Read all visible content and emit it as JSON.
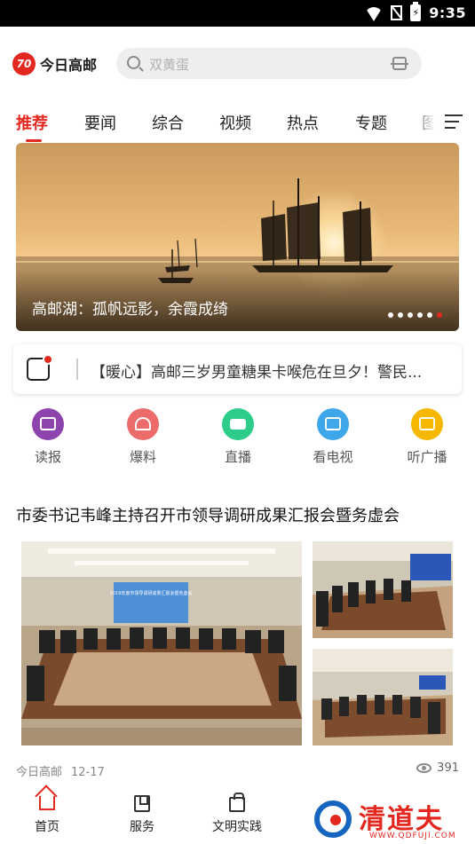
{
  "status_bar": {
    "time": "9:35",
    "battery_glyph": "⚡"
  },
  "header": {
    "logo_mark": "70",
    "logo_text": "今日高邮",
    "search_placeholder": "双黄蛋"
  },
  "tabs": [
    {
      "label": "推荐",
      "active": true
    },
    {
      "label": "要闻"
    },
    {
      "label": "综合"
    },
    {
      "label": "视频"
    },
    {
      "label": "热点"
    },
    {
      "label": "专题"
    },
    {
      "label": "图"
    }
  ],
  "banner": {
    "caption": "高邮湖：孤帆远影，余霞成绮",
    "slide_count": 6,
    "active_slide": 6
  },
  "notice": {
    "text": "【暖心】高邮三岁男童糖果卡喉危在旦夕！警民..."
  },
  "quick_links": [
    {
      "label": "读报",
      "icon": "book-icon",
      "color": "#8e44ad"
    },
    {
      "label": "爆料",
      "icon": "alarm-icon",
      "color": "#ec6b6b"
    },
    {
      "label": "直播",
      "icon": "video-camera-icon",
      "color": "#2ecc8b"
    },
    {
      "label": "看电视",
      "icon": "tv-icon",
      "color": "#3ea7e9"
    },
    {
      "label": "听广播",
      "icon": "radio-icon",
      "color": "#f5b700"
    }
  ],
  "article": {
    "title": "市委书记韦峰主持召开市领导调研成果汇报会暨务虚会",
    "screen_text": "2019年度市领导调研成果汇报会暨务虚会",
    "source": "今日高邮",
    "date": "12-17",
    "views": "391"
  },
  "bottom_nav": [
    {
      "label": "首页",
      "icon": "home-icon",
      "active": true
    },
    {
      "label": "服务",
      "icon": "service-icon"
    },
    {
      "label": "文明实践",
      "icon": "clipboard-icon"
    }
  ],
  "watermark": {
    "text": "清道夫",
    "sub": "WWW.QDFUJI.COM"
  },
  "colors": {
    "accent": "#e3281f"
  }
}
